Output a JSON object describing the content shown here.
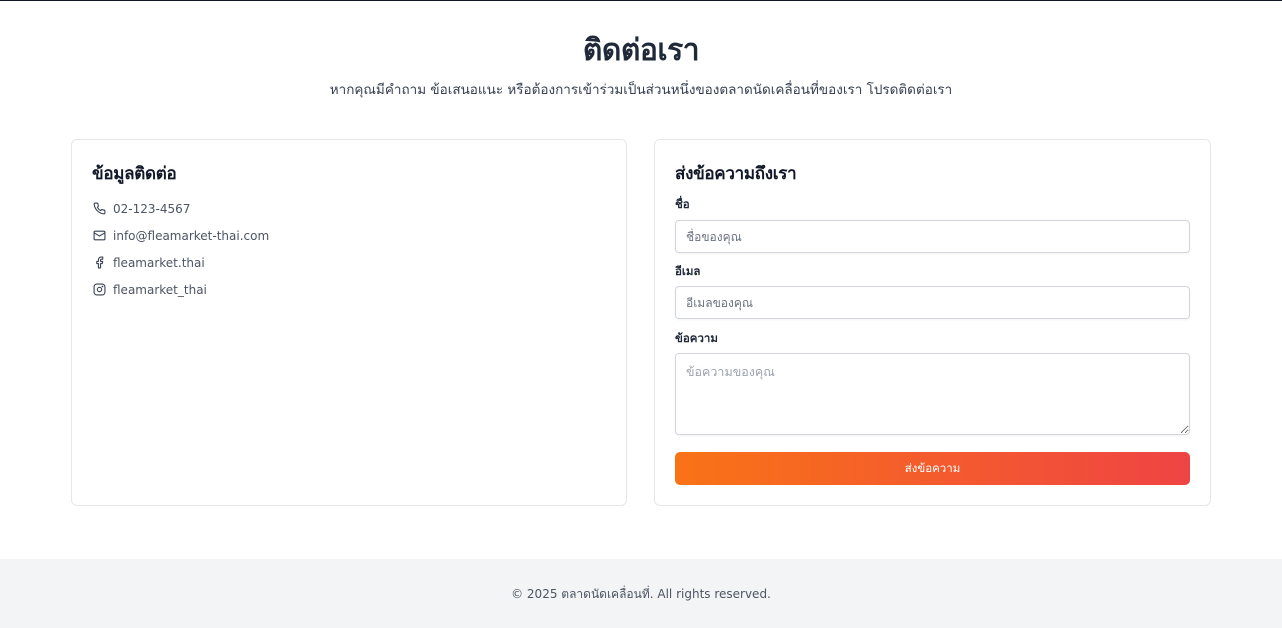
{
  "header": {
    "title": "ติดต่อเรา",
    "subtitle": "หากคุณมีคำถาม ข้อเสนอแนะ หรือต้องการเข้าร่วมเป็นส่วนหนึ่งของตลาดนัดเคลื่อนที่ของเรา โปรดติดต่อเรา"
  },
  "contact_info": {
    "title": "ข้อมูลติดต่อ",
    "items": [
      {
        "icon": "phone-icon",
        "text": "02-123-4567"
      },
      {
        "icon": "mail-icon",
        "text": "info@fleamarket-thai.com"
      },
      {
        "icon": "facebook-icon",
        "text": "fleamarket.thai"
      },
      {
        "icon": "instagram-icon",
        "text": "fleamarket_thai"
      }
    ]
  },
  "contact_form": {
    "title": "ส่งข้อความถึงเรา",
    "name_label": "ชื่อ",
    "name_placeholder": "ชื่อของคุณ",
    "email_label": "อีเมล",
    "email_placeholder": "อีเมลของคุณ",
    "message_label": "ข้อความ",
    "message_placeholder": "ข้อความของคุณ",
    "submit_label": "ส่งข้อความ",
    "button_gradient": [
      "#f97316",
      "#ef4444"
    ]
  },
  "footer": {
    "text": "© 2025 ตลาดนัดเคลื่อนที่. All rights reserved."
  }
}
